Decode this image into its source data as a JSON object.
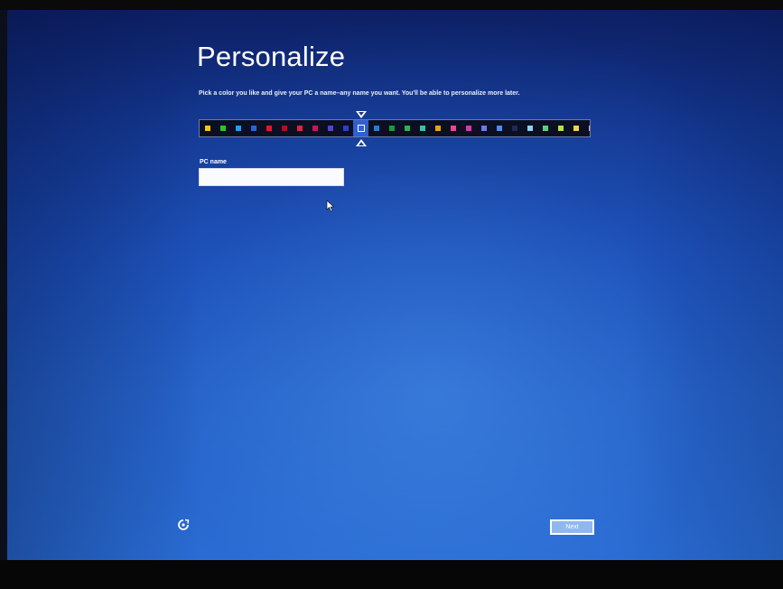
{
  "page": {
    "title": "Personalize",
    "subtitle": "Pick a color you like and give your PC a name–any name you want. You'll be able to personalize more later."
  },
  "colors": {
    "screen_bg_top": "#0d1f63",
    "screen_bg_bottom": "#2a6fd6",
    "swatches": [
      "#f2c811",
      "#2fbf3a",
      "#1ea0e8",
      "#2b63d9",
      "#e0182b",
      "#b0101c",
      "#d42a3f",
      "#c2185b",
      "#5b3fd4",
      "#2a3fd0",
      "#3260d8",
      "#1f7ed8",
      "#159f2e",
      "#2ab34e",
      "#39c2a6",
      "#f0a01c",
      "#e64a8c",
      "#d33cb0",
      "#6a7bf0",
      "#4b8ef5",
      "#1e2a55",
      "#8fd0f5",
      "#5fd07a",
      "#b8e04a",
      "#f2d44a",
      "#f5a4d0",
      "#a38cf0",
      "#6aa8f5",
      "#f2932e",
      "#20305e"
    ],
    "selected_index": 10
  },
  "form": {
    "pc_name_label": "PC name",
    "pc_name_value": ""
  },
  "footer": {
    "ease_of_access_icon": "ease-of-access-icon",
    "next_label": "Next"
  }
}
